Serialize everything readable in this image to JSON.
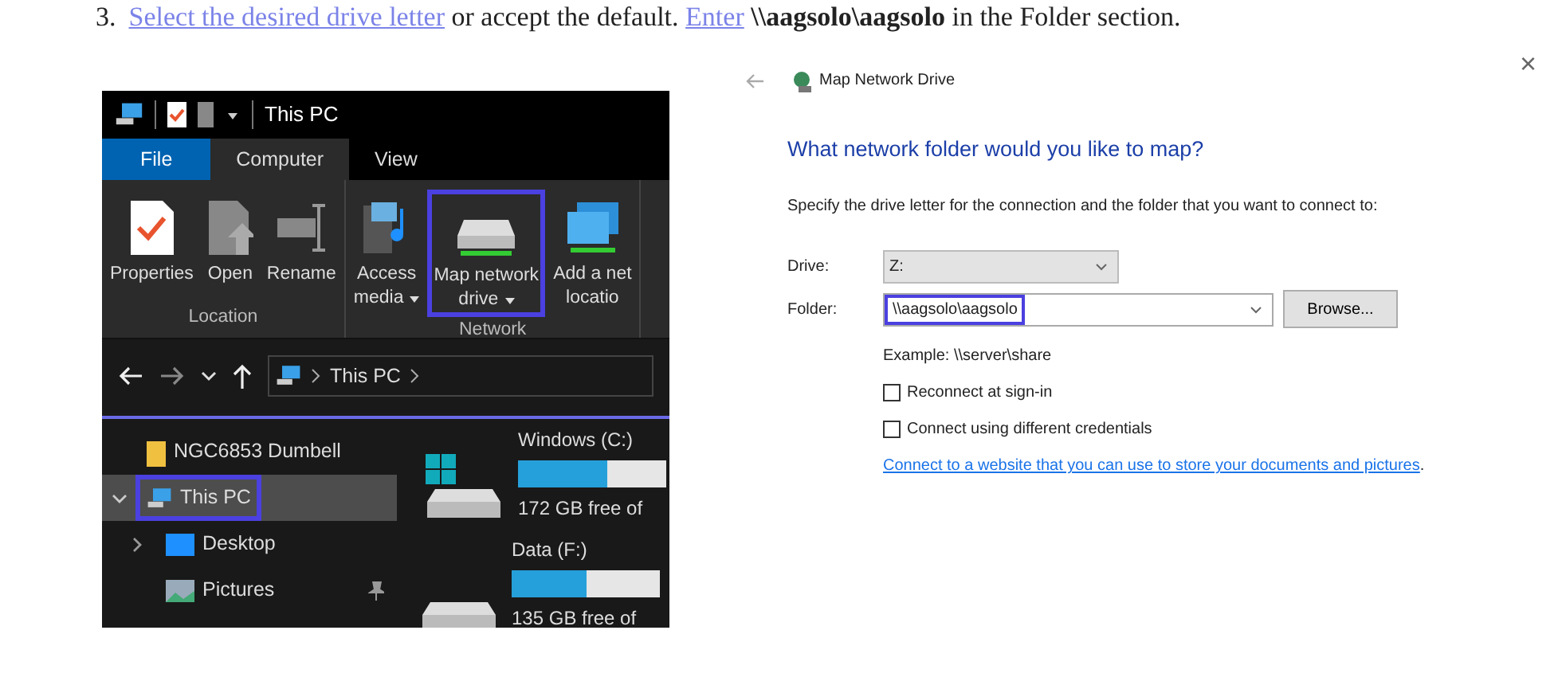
{
  "step": {
    "number": "3.",
    "segments": [
      {
        "kind": "link",
        "text": "Select the desired drive letter"
      },
      {
        "kind": "text",
        "text": " or accept the default. "
      },
      {
        "kind": "link",
        "text": "Enter"
      },
      {
        "kind": "bold",
        "text": " \\\\aagsolo\\aagsolo"
      },
      {
        "kind": "text",
        "text": " in the Folder section."
      }
    ]
  },
  "close": "×",
  "explorer": {
    "title": "This PC",
    "tabs": [
      {
        "label": "File",
        "kind": "file",
        "selected": false
      },
      {
        "label": "Computer",
        "kind": "tab",
        "selected": true
      },
      {
        "label": "View",
        "kind": "tab",
        "selected": false
      }
    ],
    "groups": [
      {
        "label": "Location",
        "buttons": [
          {
            "kind": "properties",
            "lines": [
              "Properties"
            ],
            "dropdown": false,
            "highlighted": false
          },
          {
            "kind": "open",
            "lines": [
              "Open"
            ],
            "dropdown": false,
            "highlighted": false
          },
          {
            "kind": "rename",
            "lines": [
              "Rename"
            ],
            "dropdown": false,
            "highlighted": false
          }
        ]
      },
      {
        "label": "Network",
        "buttons": [
          {
            "kind": "media",
            "lines": [
              "Access",
              "media"
            ],
            "dropdown": true,
            "highlighted": false
          },
          {
            "kind": "mapdrive",
            "lines": [
              "Map network",
              "drive"
            ],
            "dropdown": true,
            "highlighted": true
          },
          {
            "kind": "netlocation",
            "lines": [
              "Add a net",
              "locatio"
            ],
            "dropdown": false,
            "highlighted": false
          }
        ]
      }
    ],
    "address": [
      "This PC"
    ],
    "nav": [
      {
        "label": "NGC6853 Dumbell",
        "kind": "folder",
        "selected": false,
        "highlighted": false,
        "pinned": false
      },
      {
        "label": "This PC",
        "kind": "pc",
        "expanded": true,
        "selected": true,
        "highlighted": true,
        "pinned": false,
        "children": [
          {
            "label": "Desktop",
            "kind": "desktop",
            "expanded": false,
            "selected": false,
            "highlighted": false,
            "pinned": false
          },
          {
            "label": "Pictures",
            "kind": "pictures",
            "selected": false,
            "highlighted": false,
            "pinned": true
          }
        ]
      }
    ],
    "drives": [
      {
        "name": "Windows (C:)",
        "kind": "windows",
        "level": 0.6,
        "free": "172 GB free of"
      },
      {
        "name": "Data (F:)",
        "kind": "data",
        "level": 0.5,
        "free": "135 GB free of"
      }
    ]
  },
  "dialog": {
    "title": "Map Network Drive",
    "heading": "What network folder would you like to map?",
    "instruction": "Specify the drive letter for the connection and the folder that you want to connect to:",
    "fields": [
      {
        "label": "Drive:",
        "kind": "select",
        "value": "Z:",
        "highlighted": false
      },
      {
        "label": "Folder:",
        "kind": "combo",
        "value": "\\\\aagsolo\\aagsolo",
        "highlighted": true,
        "button": "Browse..."
      }
    ],
    "example": "Example: \\\\server\\share",
    "options": [
      {
        "label": "Reconnect at sign-in",
        "checked": false
      },
      {
        "label": "Connect using different credentials",
        "checked": false
      }
    ],
    "link": "Connect to a website that you can use to store your documents and pictures",
    "link_suffix": "."
  }
}
